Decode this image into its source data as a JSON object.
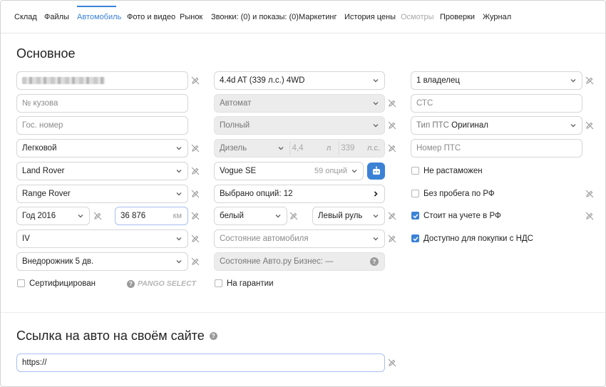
{
  "tabs": [
    "Склад",
    "Файлы",
    "Автомобиль",
    "Фото и видео",
    "Рынок",
    "Звонки: (0) и показы: (0)",
    "Маркетинг",
    "История цены",
    "Осмотры",
    "Проверки",
    "Журнал"
  ],
  "main": {
    "title": "Основное",
    "col1": {
      "vin_placeholder": "",
      "body_number": "№ кузова",
      "plate": "Гос. номер",
      "category": "Легковой",
      "make": "Land Rover",
      "model": "Range Rover",
      "year": "Год 2016",
      "mileage": "36 876",
      "mileage_unit": "км",
      "generation": "IV",
      "body_type": "Внедорожник 5 дв.",
      "certified": "Сертифицирован",
      "pango": "PANGO SELECT"
    },
    "col2": {
      "modification": "4.4d AT (339 л.с.) 4WD",
      "transmission": "Автомат",
      "drive": "Полный",
      "engine": "Дизель",
      "volume": "4,4",
      "volume_unit": "л",
      "power": "339",
      "power_unit": "л.с.",
      "trim": "Vogue SE",
      "trim_options": "59 опций",
      "options_selected": "Выбрано опций: 12",
      "color": "белый",
      "steering": "Левый руль",
      "condition": "Состояние автомобиля",
      "business_condition": "Состояние Авто.ру Бизнес: —",
      "warranty": "На гарантии"
    },
    "col3": {
      "owners": "1 владелец",
      "sts": "СТС",
      "pts_type_prefix": "Тип ПТС",
      "pts_type_value": "Оригинал",
      "pts_number": "Номер ПТС",
      "not_cleared": "Не растаможен",
      "no_mileage_rf": "Без пробега по РФ",
      "registered_rf": "Стоит на учете в РФ",
      "vat": "Доступно для покупки с НДС"
    },
    "checks": {
      "not_cleared": false,
      "no_mileage_rf": false,
      "registered_rf": true,
      "vat": true,
      "certified": false,
      "warranty": false
    }
  },
  "link": {
    "title": "Ссылка на авто на своём сайте",
    "value": "https://"
  }
}
